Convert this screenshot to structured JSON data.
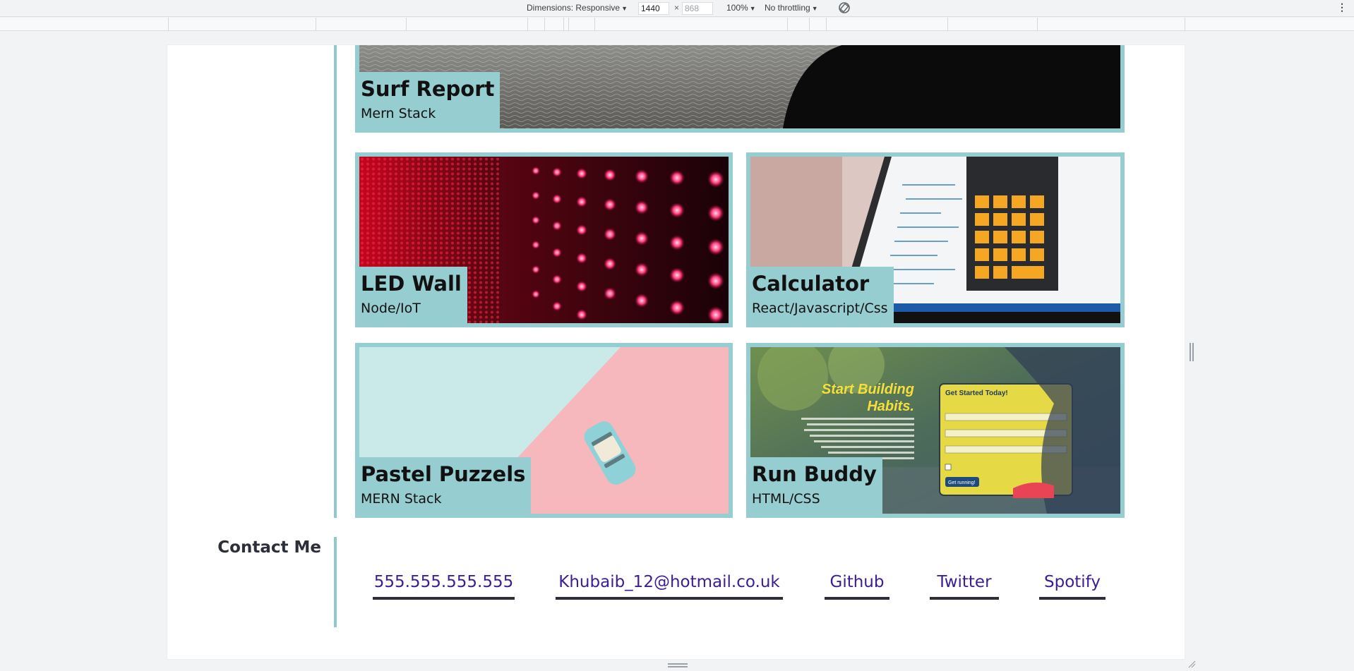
{
  "devtools": {
    "dimensions_label": "Dimensions: Responsive",
    "width_value": "1440",
    "height_value": "868",
    "zoom": "100%",
    "throttling": "No throttling"
  },
  "projects": [
    {
      "title": "Surf Report",
      "stack": "Mern Stack"
    },
    {
      "title": "LED Wall",
      "stack": "Node/IoT"
    },
    {
      "title": "Calculator",
      "stack": "React/Javascript/Css"
    },
    {
      "title": "Pastel Puzzels",
      "stack": "MERN Stack"
    },
    {
      "title": "Run Buddy",
      "stack": "HTML/CSS"
    }
  ],
  "runbuddy_art": {
    "headline_1": "Start Building",
    "headline_2": "Habits.",
    "form_title": "Get Started Today!",
    "form_button": "Get running!"
  },
  "contact": {
    "heading": "Contact Me",
    "links": [
      {
        "label": "555.555.555.555"
      },
      {
        "label": "Khubaib_12@hotmail.co.uk"
      },
      {
        "label": "Github"
      },
      {
        "label": "Twitter"
      },
      {
        "label": "Spotify"
      }
    ]
  },
  "colors": {
    "accent": "#95cdd1",
    "link": "#3b1d96",
    "underline": "#2c2f3a"
  }
}
